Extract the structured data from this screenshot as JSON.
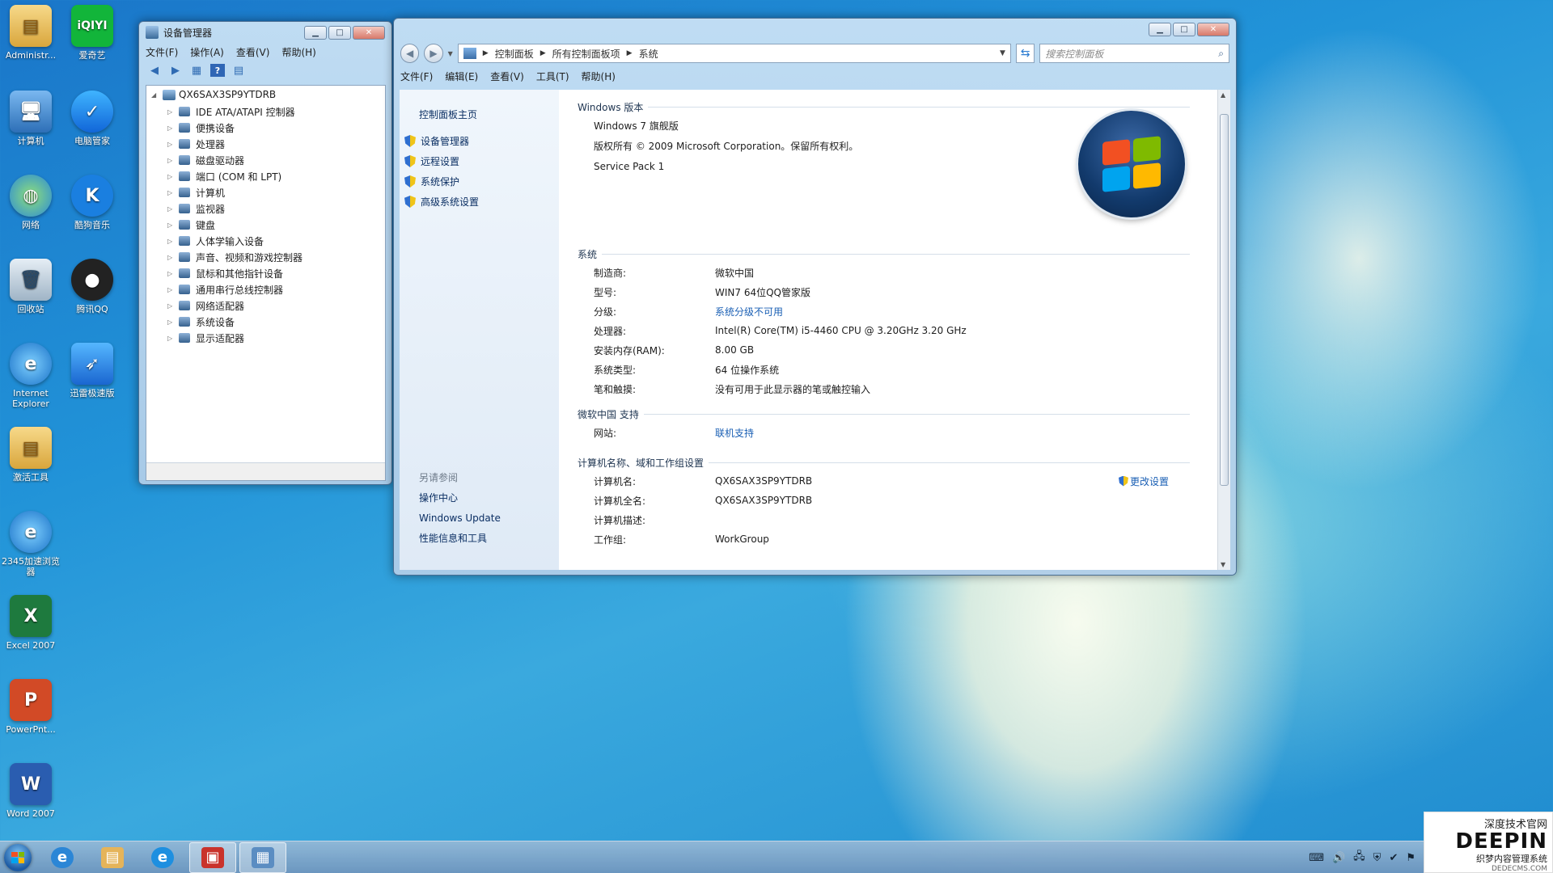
{
  "desktop": {
    "icons": [
      {
        "label": "Administr..."
      },
      {
        "label": "爱奇艺"
      },
      {
        "label": "计算机"
      },
      {
        "label": "电脑管家"
      },
      {
        "label": "网络"
      },
      {
        "label": "酷狗音乐"
      },
      {
        "label": "回收站"
      },
      {
        "label": "腾讯QQ"
      },
      {
        "label": "Internet Explorer"
      },
      {
        "label": "迅雷极速版"
      },
      {
        "label": "激活工具"
      },
      {
        "label": "2345加速浏览器"
      },
      {
        "label": "Excel 2007"
      },
      {
        "label": "PowerPnt..."
      },
      {
        "label": "Word 2007"
      }
    ],
    "iqiyi_mark": "iQIYI"
  },
  "device_manager": {
    "title": "设备管理器",
    "menu": [
      "文件(F)",
      "操作(A)",
      "查看(V)",
      "帮助(H)"
    ],
    "root": "QX6SAX3SP9YTDRB",
    "items": [
      "IDE ATA/ATAPI 控制器",
      "便携设备",
      "处理器",
      "磁盘驱动器",
      "端口 (COM 和 LPT)",
      "计算机",
      "监视器",
      "键盘",
      "人体学输入设备",
      "声音、视频和游戏控制器",
      "鼠标和其他指针设备",
      "通用串行总线控制器",
      "网络适配器",
      "系统设备",
      "显示适配器"
    ]
  },
  "system_window": {
    "breadcrumb": [
      "控制面板",
      "所有控制面板项",
      "系统"
    ],
    "search_placeholder": "搜索控制面板",
    "menu": [
      "文件(F)",
      "编辑(E)",
      "查看(V)",
      "工具(T)",
      "帮助(H)"
    ],
    "sidebar": {
      "home": "控制面板主页",
      "links": [
        "设备管理器",
        "远程设置",
        "系统保护",
        "高级系统设置"
      ],
      "see_also_header": "另请参阅",
      "see_also": [
        "操作中心",
        "Windows Update",
        "性能信息和工具"
      ]
    },
    "edition": {
      "header": "Windows 版本",
      "name": "Windows 7 旗舰版",
      "copyright": "版权所有 © 2009 Microsoft Corporation。保留所有权利。",
      "service_pack": "Service Pack 1"
    },
    "system": {
      "header": "系统",
      "rows": [
        {
          "k": "制造商:",
          "v": "微软中国"
        },
        {
          "k": "型号:",
          "v": "WIN7 64位QQ管家版"
        },
        {
          "k": "分级:",
          "v": "系统分级不可用"
        },
        {
          "k": "处理器:",
          "v": "Intel(R) Core(TM) i5-4460  CPU @ 3.20GHz   3.20 GHz"
        },
        {
          "k": "安装内存(RAM):",
          "v": "8.00 GB"
        },
        {
          "k": "系统类型:",
          "v": "64 位操作系统"
        },
        {
          "k": "笔和触摸:",
          "v": "没有可用于此显示器的笔或触控输入"
        }
      ]
    },
    "support": {
      "header": "微软中国 支持",
      "k": "网站:",
      "v": "联机支持"
    },
    "computer": {
      "header": "计算机名称、域和工作组设置",
      "change_label": "更改设置",
      "rows": [
        {
          "k": "计算机名:",
          "v": "QX6SAX3SP9YTDRB"
        },
        {
          "k": "计算机全名:",
          "v": "QX6SAX3SP9YTDRB"
        },
        {
          "k": "计算机描述:",
          "v": ""
        },
        {
          "k": "工作组:",
          "v": "WorkGroup"
        }
      ]
    }
  },
  "watermark": {
    "line1": "深度技术官网",
    "brand": "DEEPIN",
    "line3": "织梦内容管理系统",
    "url": "DEDECMS.COM"
  },
  "colors": {
    "link": "#1a5fb4",
    "win_blue": "#1d5aa3",
    "flag_red": "#f25022",
    "flag_green": "#7fba00",
    "flag_blue": "#00a4ef",
    "flag_yellow": "#ffb900"
  }
}
